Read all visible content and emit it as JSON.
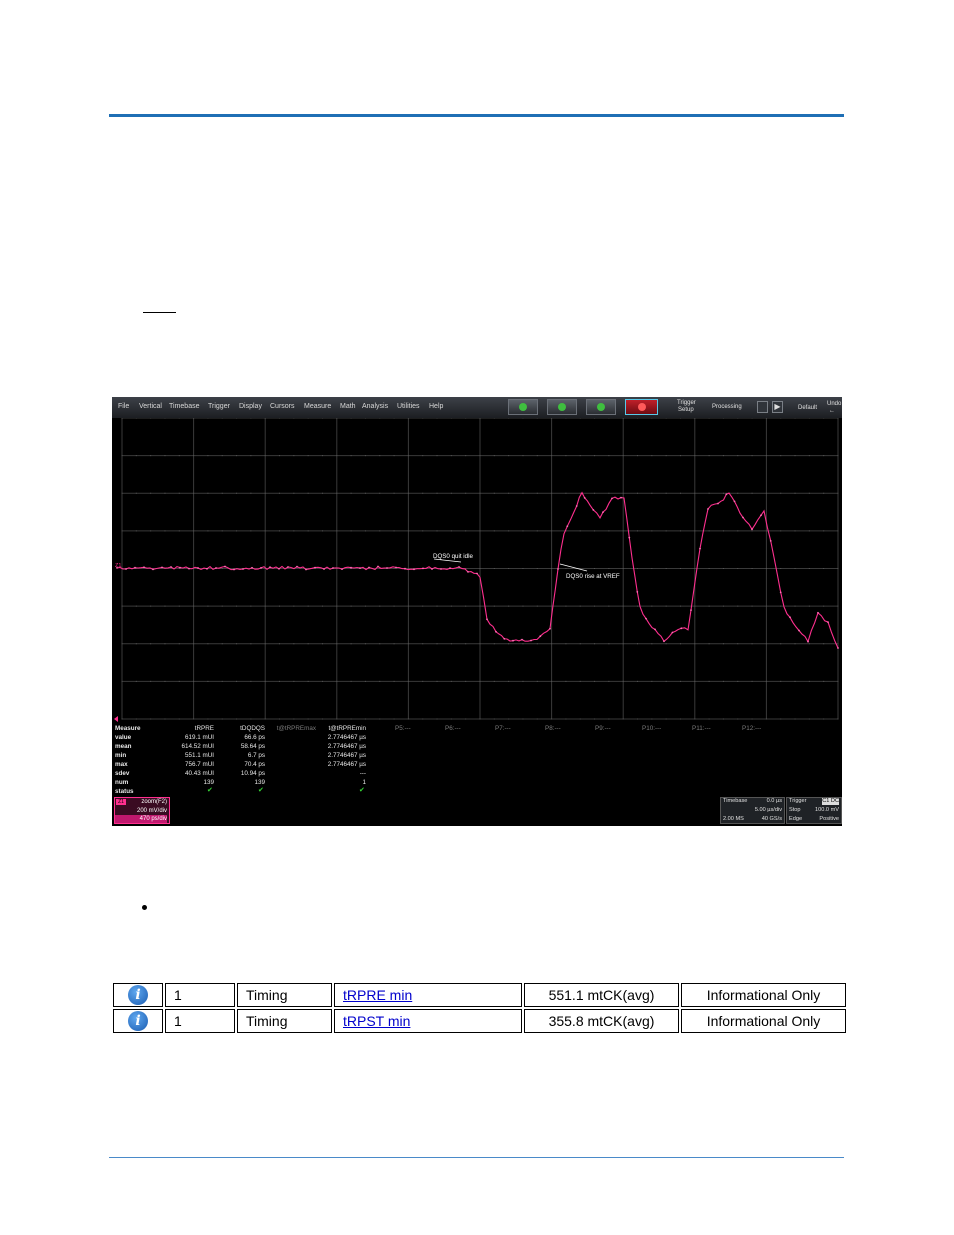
{
  "scope": {
    "menu": [
      "File",
      "Vertical",
      "Timebase",
      "Trigger",
      "Display",
      "Cursors",
      "Measure",
      "Math",
      "Analysis",
      "Utilities",
      "Help"
    ],
    "toolbar": {
      "trigger_setup": [
        "Trigger",
        "Setup"
      ],
      "processing": "Processing",
      "default": "Default",
      "undo": [
        "Undo",
        "←"
      ]
    },
    "annotations": {
      "quit_idle": "DQS0 quit idle",
      "rise_vref": "DQS0 rise at VREF"
    },
    "measure": {
      "row_labels": [
        "Measure",
        "value",
        "mean",
        "min",
        "max",
        "sdev",
        "num",
        "status"
      ],
      "columns": [
        {
          "header": "tRPRE",
          "values": [
            "619.1 mUI",
            "614.52 mUI",
            "551.1 mUI",
            "756.7 mUI",
            "40.43 mUI",
            "139"
          ],
          "status": "✔",
          "dim": false
        },
        {
          "header": "tDQDQS",
          "values": [
            "66.6 ps",
            "58.64 ps",
            "6.7 ps",
            "70.4 ps",
            "10.94 ps",
            "139"
          ],
          "status": "✔",
          "dim": false
        },
        {
          "header": "t@tRPREmax",
          "values": [],
          "status": "",
          "dim": true
        },
        {
          "header": "t@tRPREmin",
          "values": [
            "2.7746467 µs",
            "2.7746467 µs",
            "2.7746467 µs",
            "2.7746467 µs",
            "---",
            "1"
          ],
          "status": "✔",
          "dim": false
        }
      ],
      "params": [
        "P5:---",
        "P6:---",
        "P7:---",
        "P8:---",
        "P9:---",
        "P10:---",
        "P11:---",
        "P12:---"
      ]
    },
    "zoom": {
      "tag": "Z1",
      "label": "zoom(F2)",
      "vdiv": "200 mV/div",
      "hdiv": "470 ps/div"
    },
    "timebase": {
      "label": "Timebase",
      "offset": "0.0 µs",
      "tdiv": "5.00 µs/div",
      "samples": "2.00 MS",
      "rate": "40 GS/s"
    },
    "trigger": {
      "label": "Trigger",
      "chan": "C1 DC",
      "mode": "Stop",
      "level": "100.0 mV",
      "type": "Edge",
      "slope": "Positive"
    },
    "channel_marker": "Z1",
    "trace_color": "#ff2f8f"
  },
  "table": {
    "rows": [
      {
        "icon": "info-icon",
        "icon_glyph": "i",
        "num": "1",
        "category": "Timing",
        "test": "tRPRE min",
        "value": "551.1 mtCK(avg)",
        "result": "Informational Only"
      },
      {
        "icon": "info-icon",
        "icon_glyph": "i",
        "num": "1",
        "category": "Timing",
        "test": "tRPST min",
        "value": "355.8 mtCK(avg)",
        "result": "Informational Only"
      }
    ]
  },
  "colors": {
    "rule": "#1f6fb5",
    "trace": "#ff2f8f",
    "link": "#0000cc",
    "pass": "#35d435"
  }
}
